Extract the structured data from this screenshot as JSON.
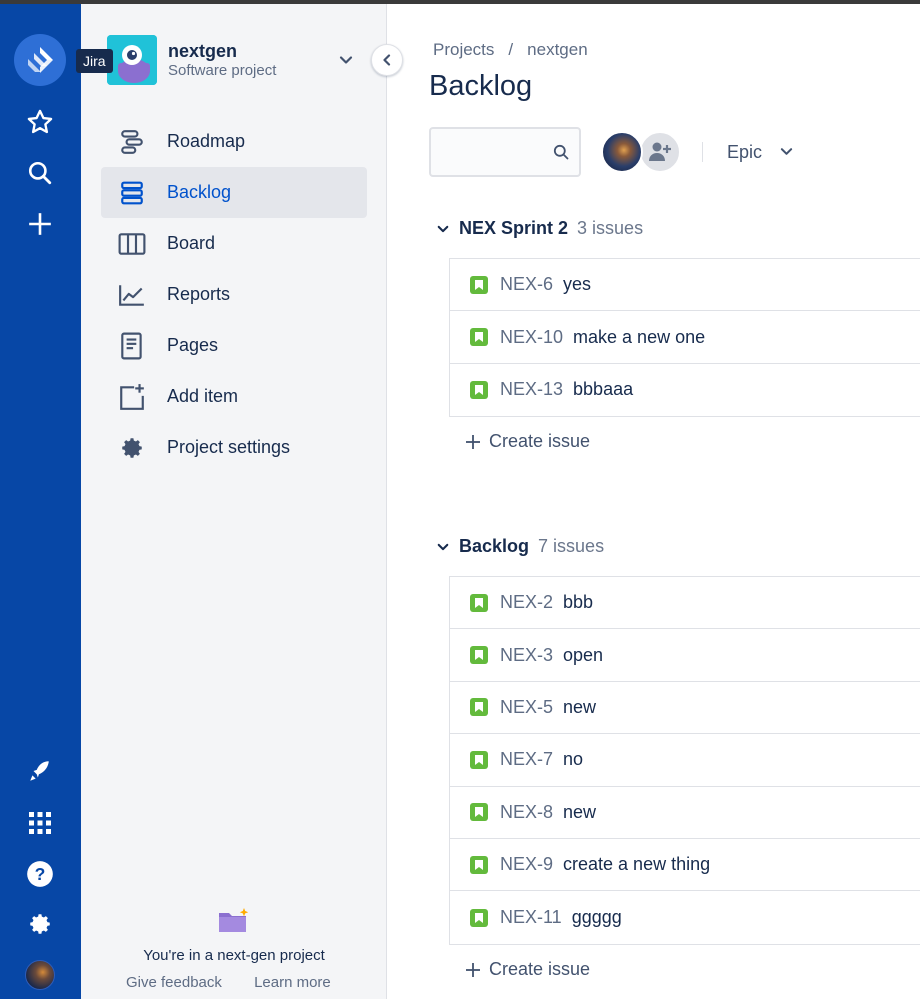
{
  "global_nav": {
    "tooltip": "Jira",
    "top_icons": [
      "jira-logo",
      "star-icon",
      "search-icon",
      "plus-icon"
    ],
    "bottom_icons": [
      "rocket-icon",
      "app-switcher-icon",
      "help-icon",
      "settings-icon",
      "avatar"
    ]
  },
  "project": {
    "name": "nextgen",
    "type": "Software project"
  },
  "sidebar": {
    "items": [
      {
        "label": "Roadmap",
        "icon": "roadmap-icon",
        "active": false
      },
      {
        "label": "Backlog",
        "icon": "backlog-icon",
        "active": true
      },
      {
        "label": "Board",
        "icon": "board-icon",
        "active": false
      },
      {
        "label": "Reports",
        "icon": "reports-icon",
        "active": false
      },
      {
        "label": "Pages",
        "icon": "pages-icon",
        "active": false
      },
      {
        "label": "Add item",
        "icon": "add-item-icon",
        "active": false
      },
      {
        "label": "Project settings",
        "icon": "gear-icon",
        "active": false
      }
    ],
    "footer": {
      "text": "You're in a next-gen project",
      "feedback": "Give feedback",
      "learn_more": "Learn more"
    }
  },
  "breadcrumb": {
    "root": "Projects",
    "separator": "/",
    "current": "nextgen"
  },
  "page": {
    "title": "Backlog"
  },
  "toolbar": {
    "search_placeholder": "",
    "epic_label": "Epic"
  },
  "sprint": {
    "name": "NEX Sprint 2",
    "count": "3 issues",
    "issues": [
      {
        "key": "NEX-6",
        "summary": "yes"
      },
      {
        "key": "NEX-10",
        "summary": "make a new one"
      },
      {
        "key": "NEX-13",
        "summary": "bbbaaa"
      }
    ],
    "create_label": "Create issue"
  },
  "backlog": {
    "name": "Backlog",
    "count": "7 issues",
    "issues": [
      {
        "key": "NEX-2",
        "summary": "bbb"
      },
      {
        "key": "NEX-3",
        "summary": "open"
      },
      {
        "key": "NEX-5",
        "summary": "new"
      },
      {
        "key": "NEX-7",
        "summary": "no"
      },
      {
        "key": "NEX-8",
        "summary": "new"
      },
      {
        "key": "NEX-9",
        "summary": "create a new thing"
      },
      {
        "key": "NEX-11",
        "summary": "ggggg"
      }
    ],
    "create_label": "Create issue"
  },
  "colors": {
    "global_nav": "#0747a6",
    "sidebar_bg": "#f4f5f7",
    "active_link": "#0052cc",
    "story_green": "#63ba3c",
    "project_avatar": "#20c2d8"
  }
}
